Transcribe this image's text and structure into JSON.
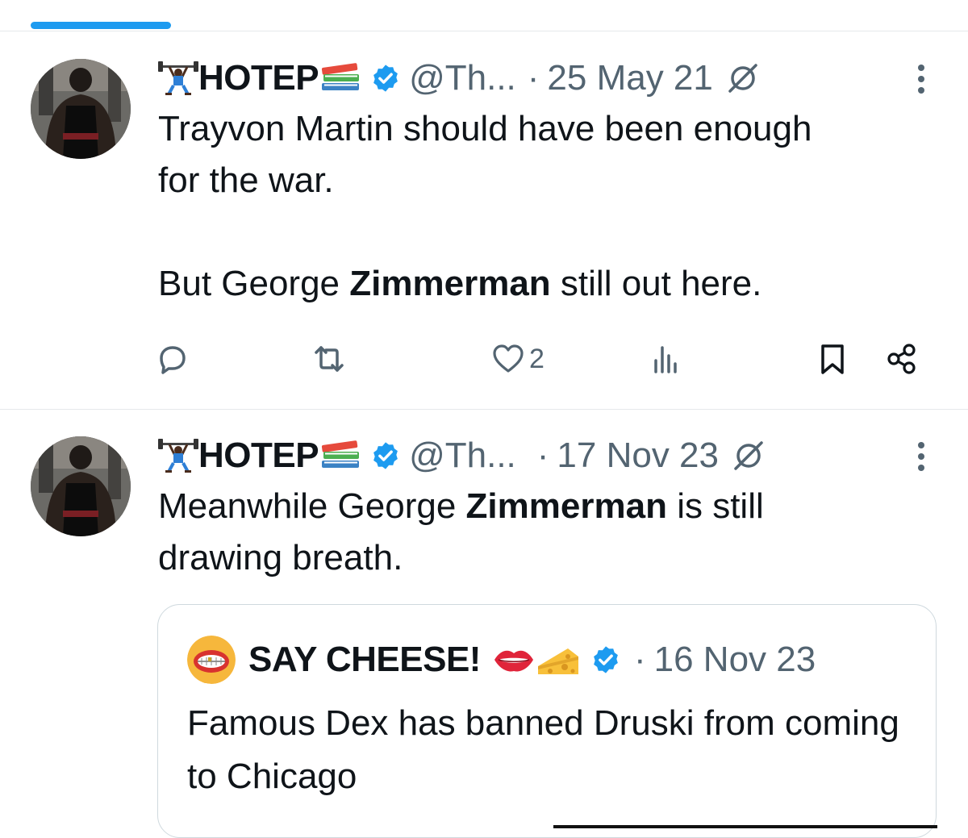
{
  "icons": {
    "weightlifter": "weightlifter-emoji",
    "books": "books-emoji",
    "verified": "verified-badge-icon",
    "edited": "edited-icon",
    "more": "more-vertical-icon",
    "reply": "reply-icon",
    "retweet": "retweet-icon",
    "like": "heart-icon",
    "views": "views-icon",
    "bookmark": "bookmark-icon",
    "share": "share-icon",
    "lips": "lips-emoji",
    "cheese": "cheese-emoji"
  },
  "colors": {
    "accent": "#1d9bf0",
    "text": "#0f1419",
    "secondary": "#536471",
    "divider": "#e6e9eb"
  },
  "tweets": [
    {
      "author": {
        "name": "HOTEP",
        "handle": "@Th...",
        "verified": true
      },
      "dot": "·",
      "date": "25 May 21",
      "text_plain_1": "Trayvon Martin should have been enough\nfor the war.\n\nBut George ",
      "text_bold": "Zimmerman",
      "text_plain_2": " still out here.",
      "actions": {
        "like_count": "2"
      }
    },
    {
      "author": {
        "name": "HOTEP",
        "handle": "@Th...",
        "verified": true
      },
      "dot": "·",
      "date": "17 Nov 23",
      "text_plain_1": "Meanwhile George ",
      "text_bold": "Zimmerman",
      "text_plain_2": " is still\ndrawing breath.",
      "quote": {
        "author_name": "SAY CHEESE!",
        "verified": true,
        "dot": "·",
        "date": "16 Nov 23",
        "text": "Famous Dex has banned Druski from coming to Chicago"
      }
    }
  ]
}
